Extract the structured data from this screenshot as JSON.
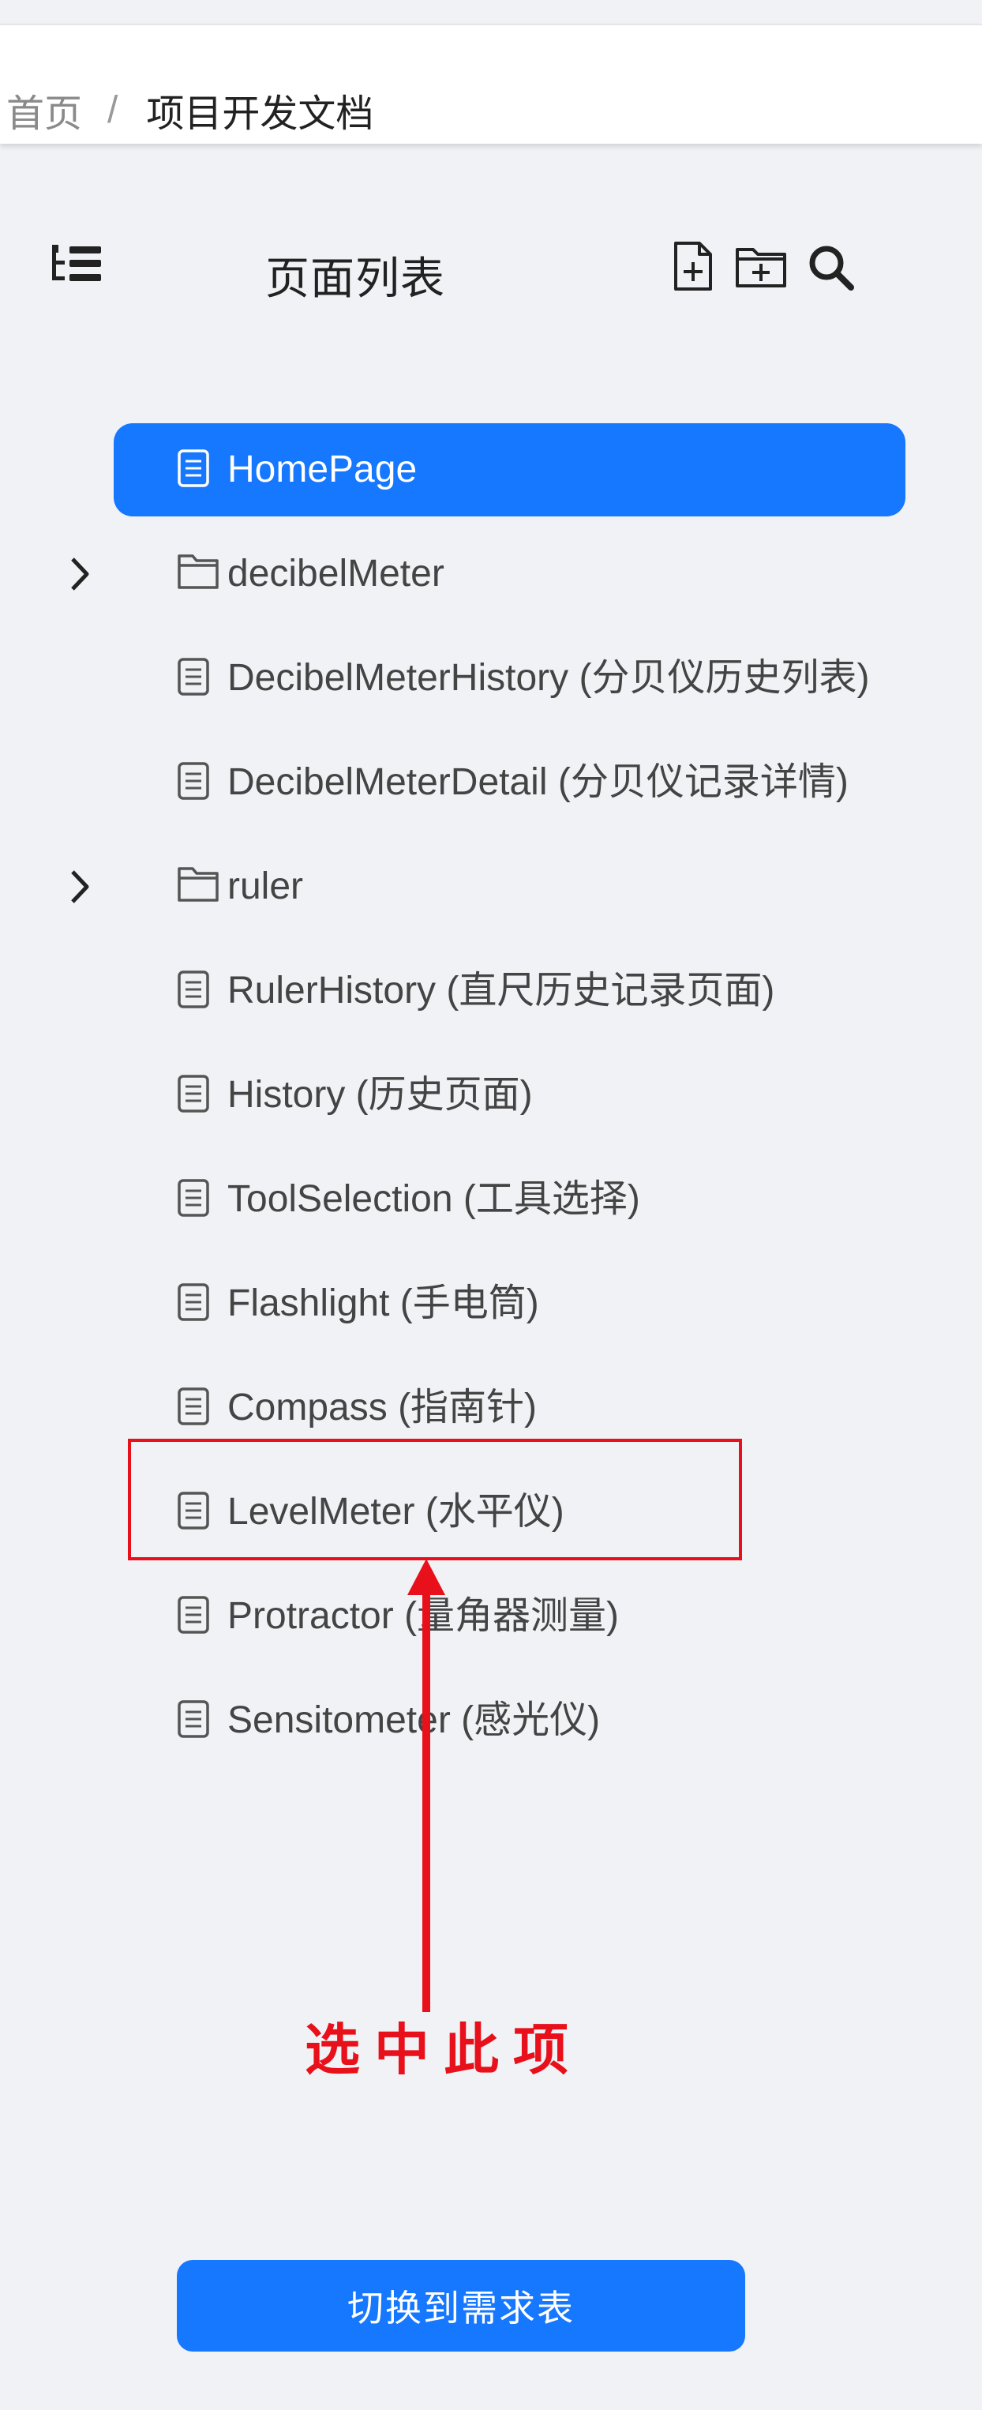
{
  "breadcrumb": {
    "home": "首页",
    "separator": "/",
    "current": "项目开发文档"
  },
  "panel": {
    "title": "页面列表",
    "icons": [
      "tree-list-icon",
      "new-file-icon",
      "new-folder-icon",
      "search-icon"
    ]
  },
  "tree": [
    {
      "label": "HomePage",
      "type": "doc",
      "selected": true
    },
    {
      "label": "decibelMeter",
      "type": "folder",
      "expandable": true
    },
    {
      "label": "DecibelMeterHistory (分贝仪历史列表)",
      "type": "doc"
    },
    {
      "label": "DecibelMeterDetail (分贝仪记录详情)",
      "type": "doc"
    },
    {
      "label": "ruler",
      "type": "folder",
      "expandable": true
    },
    {
      "label": "RulerHistory (直尺历史记录页面)",
      "type": "doc"
    },
    {
      "label": "History (历史页面)",
      "type": "doc"
    },
    {
      "label": "ToolSelection (工具选择)",
      "type": "doc"
    },
    {
      "label": "Flashlight (手电筒)",
      "type": "doc"
    },
    {
      "label": "Compass (指南针)",
      "type": "doc"
    },
    {
      "label": "LevelMeter (水平仪)",
      "type": "doc"
    },
    {
      "label": "Protractor (量角器测量)",
      "type": "doc"
    },
    {
      "label": "Sensitometer (感光仪)",
      "type": "doc"
    }
  ],
  "annotation": {
    "text": "选中此项",
    "color": "#e8101a"
  },
  "footer": {
    "switch_button": "切换到需求表"
  },
  "colors": {
    "accent": "#1677ff",
    "background": "#f0f2f5"
  }
}
